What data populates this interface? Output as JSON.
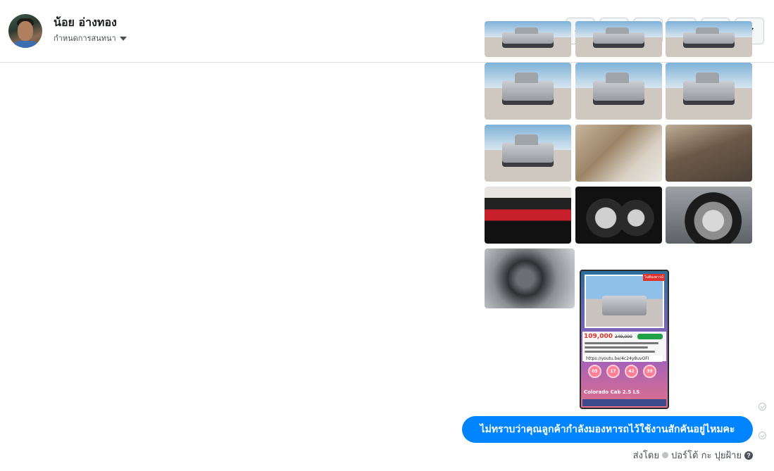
{
  "header": {
    "name": "น้อย อ่างทอง",
    "assign_label": "กำหนดการสนทนา"
  },
  "toolbar": [
    {
      "name": "report-button",
      "icon": "alert-circle-icon"
    },
    {
      "name": "delete-button",
      "icon": "trash-icon"
    },
    {
      "name": "star-button",
      "icon": "star-icon"
    },
    {
      "name": "mark-unread-button",
      "icon": "envelope-icon"
    },
    {
      "name": "important-button",
      "icon": "exclamation-icon",
      "label": "!"
    },
    {
      "name": "done-button",
      "icon": "checkmark-icon"
    }
  ],
  "poster": {
    "tag": "ไม่ต้องดาวน์",
    "price": "109,000",
    "old_price": "249,000",
    "link": "https://youtu.be/4c24y8uvOFI",
    "numbers": [
      "05",
      "17",
      "42",
      "39"
    ],
    "model": "Colorado Cab 2.5 LS"
  },
  "message": {
    "text": "ไม่ทราบว่าคุณลูกค้ากำลังมองหารถไว้ใช้งานสักคันอยู่ไหมคะ",
    "sent_by_prefix": "ส่งโดย",
    "sender": "ปอร์โต้ กะ ปุยฝ้าย",
    "help_glyph": "?"
  },
  "colors": {
    "accent": "#0084ff",
    "border": "#dddfe2"
  }
}
